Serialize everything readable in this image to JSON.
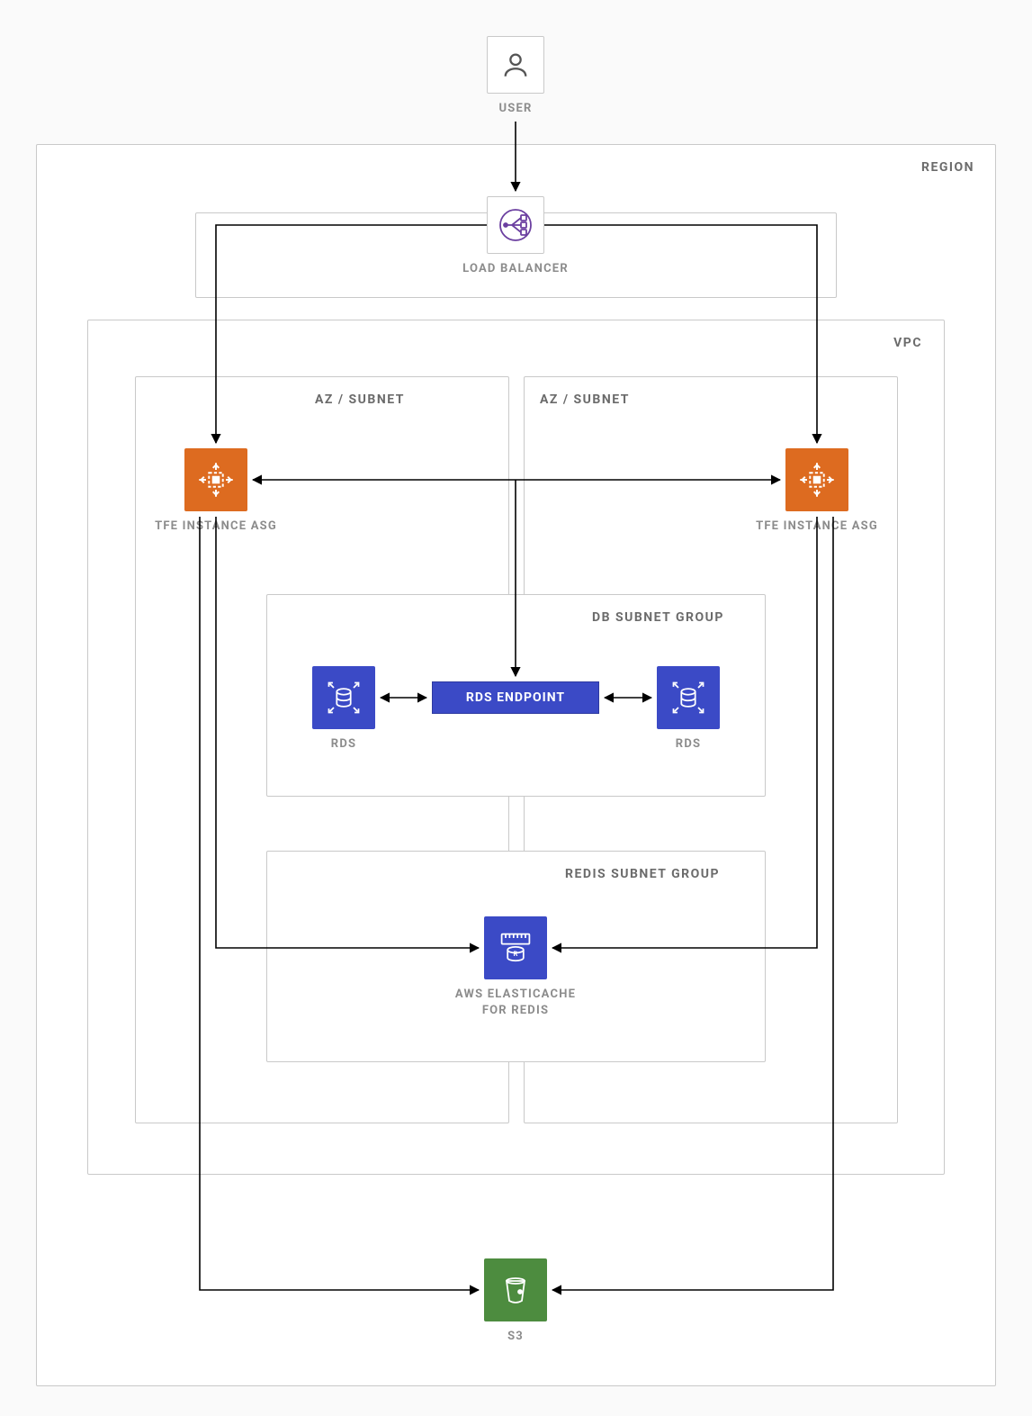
{
  "labels": {
    "user": "USER",
    "region": "REGION",
    "vpc": "VPC",
    "load_balancer": "LOAD BALANCER",
    "az_left": "AZ / SUBNET",
    "az_right": "AZ / SUBNET",
    "tfe_left": "TFE INSTANCE ASG",
    "tfe_right": "TFE INSTANCE ASG",
    "db_subnet": "DB SUBNET GROUP",
    "rds_endpoint": "RDS ENDPOINT",
    "rds_left": "RDS",
    "rds_right": "RDS",
    "redis_subnet": "REDIS SUBNET GROUP",
    "elasticache": "AWS ELASTICACHE\nFOR REDIS",
    "s3": "S3"
  },
  "colors": {
    "orange": "#DD6B20",
    "blue": "#3b4ac6",
    "green": "#4D8C3F",
    "purple": "#6B3FA0",
    "border": "#c9c9c9",
    "text_muted": "#8c8c8c"
  },
  "diagram": {
    "type": "architecture",
    "description": "AWS multi-AZ deployment of Terraform Enterprise (TFE) with load balancer, two AZ subnets each containing a TFE instance ASG, a shared RDS endpoint in a DB subnet group with two RDS nodes, an ElastiCache Redis in a Redis subnet group, and S3 storage; all inside a VPC within a Region.",
    "nodes": [
      {
        "id": "user",
        "label": "USER"
      },
      {
        "id": "lb",
        "label": "LOAD BALANCER"
      },
      {
        "id": "tfe_left",
        "label": "TFE INSTANCE ASG",
        "az": "left"
      },
      {
        "id": "tfe_right",
        "label": "TFE INSTANCE ASG",
        "az": "right"
      },
      {
        "id": "rds_endpoint",
        "label": "RDS ENDPOINT"
      },
      {
        "id": "rds_left",
        "label": "RDS"
      },
      {
        "id": "rds_right",
        "label": "RDS"
      },
      {
        "id": "elasticache",
        "label": "AWS ELASTICACHE FOR REDIS"
      },
      {
        "id": "s3",
        "label": "S3"
      }
    ],
    "edges": [
      {
        "from": "user",
        "to": "lb",
        "dir": "forward"
      },
      {
        "from": "lb",
        "to": "tfe_left",
        "dir": "forward"
      },
      {
        "from": "lb",
        "to": "tfe_right",
        "dir": "forward"
      },
      {
        "from": "tfe_left",
        "to": "tfe_right",
        "dir": "both"
      },
      {
        "from": "tfe_left",
        "to": "rds_endpoint",
        "dir": "both",
        "via": "merged"
      },
      {
        "from": "tfe_right",
        "to": "rds_endpoint",
        "dir": "both",
        "via": "merged"
      },
      {
        "from": "rds_endpoint",
        "to": "rds_left",
        "dir": "both"
      },
      {
        "from": "rds_endpoint",
        "to": "rds_right",
        "dir": "both"
      },
      {
        "from": "tfe_left",
        "to": "elasticache",
        "dir": "forward"
      },
      {
        "from": "tfe_right",
        "to": "elasticache",
        "dir": "forward"
      },
      {
        "from": "tfe_left",
        "to": "s3",
        "dir": "forward"
      },
      {
        "from": "tfe_right",
        "to": "s3",
        "dir": "forward"
      }
    ],
    "containers": [
      {
        "id": "region",
        "label": "REGION",
        "contains": [
          "vpc",
          "lb",
          "s3"
        ]
      },
      {
        "id": "vpc",
        "label": "VPC",
        "contains": [
          "az_left",
          "az_right"
        ]
      },
      {
        "id": "az_left",
        "label": "AZ / SUBNET",
        "contains": [
          "tfe_left"
        ]
      },
      {
        "id": "az_right",
        "label": "AZ / SUBNET",
        "contains": [
          "tfe_right"
        ]
      },
      {
        "id": "db_subnet",
        "label": "DB SUBNET GROUP",
        "contains": [
          "rds_left",
          "rds_endpoint",
          "rds_right"
        ],
        "spans": [
          "az_left",
          "az_right"
        ]
      },
      {
        "id": "redis_subnet",
        "label": "REDIS SUBNET GROUP",
        "contains": [
          "elasticache"
        ],
        "spans": [
          "az_left",
          "az_right"
        ]
      }
    ]
  }
}
